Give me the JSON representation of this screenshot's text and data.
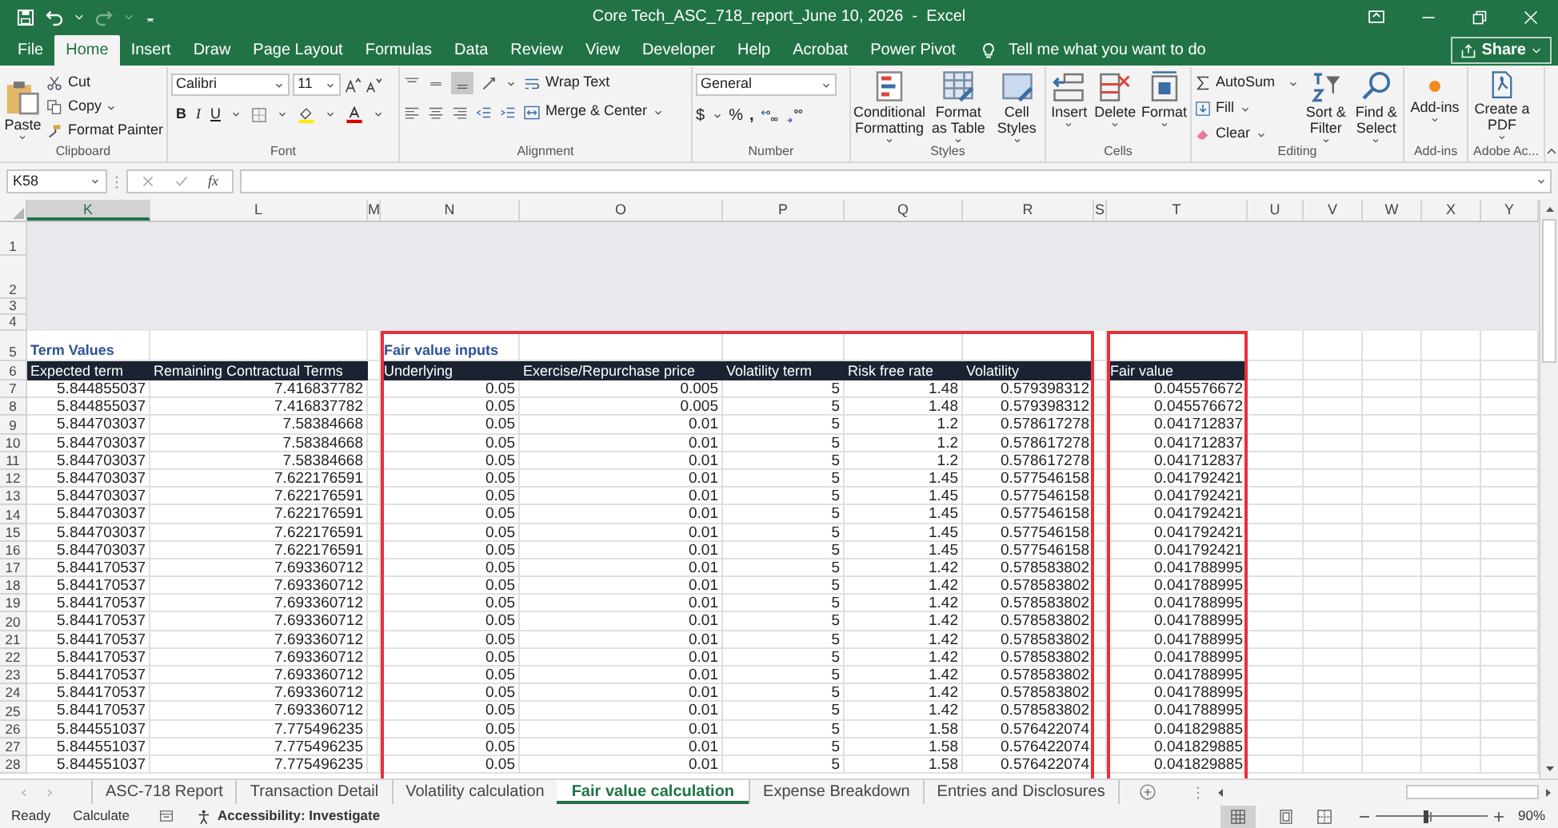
{
  "title_bar": {
    "title": "Core Tech_ASC_718_report_June 10, 2026  -  Excel"
  },
  "menu_tabs": [
    {
      "label": "File",
      "selected": false
    },
    {
      "label": "Home",
      "selected": true
    },
    {
      "label": "Insert",
      "selected": false
    },
    {
      "label": "Draw",
      "selected": false
    },
    {
      "label": "Page Layout",
      "selected": false
    },
    {
      "label": "Formulas",
      "selected": false
    },
    {
      "label": "Data",
      "selected": false
    },
    {
      "label": "Review",
      "selected": false
    },
    {
      "label": "View",
      "selected": false
    },
    {
      "label": "Developer",
      "selected": false
    },
    {
      "label": "Help",
      "selected": false
    },
    {
      "label": "Acrobat",
      "selected": false
    },
    {
      "label": "Power Pivot",
      "selected": false
    }
  ],
  "tell_me": {
    "placeholder": "Tell me what you want to do"
  },
  "share_button": "Share",
  "ribbon": {
    "clipboard": {
      "label": "Clipboard",
      "paste": "Paste",
      "cut": "Cut",
      "copy": "Copy",
      "format_painter": "Format Painter"
    },
    "font": {
      "label": "Font",
      "font_name": "Calibri",
      "font_size": "11",
      "bold": "B",
      "italic": "I",
      "underline": "U"
    },
    "alignment": {
      "label": "Alignment",
      "wrap_text": "Wrap Text",
      "merge_center": "Merge & Center"
    },
    "number": {
      "label": "Number",
      "format": "General",
      "currency": "$",
      "percent": "%",
      "comma": ","
    },
    "styles": {
      "label": "Styles",
      "conditional_formatting": "Conditional Formatting",
      "format_as_table": "Format as Table",
      "cell_styles": "Cell Styles"
    },
    "cells": {
      "label": "Cells",
      "insert": "Insert",
      "delete": "Delete",
      "format": "Format"
    },
    "editing": {
      "label": "Editing",
      "autosum": "AutoSum",
      "fill": "Fill",
      "clear": "Clear",
      "sort_filter": "Sort & Filter",
      "find_select": "Find & Select"
    },
    "add_ins": {
      "label": "Add-ins",
      "add_ins": "Add-ins"
    },
    "adobe": {
      "label": "Adobe Ac...",
      "create_pdf": "Create a PDF"
    }
  },
  "formula_bar": {
    "name_box": "K58",
    "function_button": "fx"
  },
  "sheet": {
    "columns": [
      {
        "label": "K",
        "selected": true
      },
      {
        "label": "L",
        "selected": false
      },
      {
        "label": "M",
        "selected": false
      },
      {
        "label": "N",
        "selected": false
      },
      {
        "label": "O",
        "selected": false
      },
      {
        "label": "P",
        "selected": false
      },
      {
        "label": "Q",
        "selected": false
      },
      {
        "label": "R",
        "selected": false
      },
      {
        "label": "S",
        "selected": false
      },
      {
        "label": "T",
        "selected": false
      },
      {
        "label": "U",
        "selected": false
      },
      {
        "label": "V",
        "selected": false
      },
      {
        "label": "W",
        "selected": false
      },
      {
        "label": "X",
        "selected": false
      },
      {
        "label": "Y",
        "selected": false
      }
    ],
    "rows": [
      {
        "number": "1",
        "kind": "band"
      },
      {
        "number": "2",
        "kind": "band"
      },
      {
        "number": "3",
        "kind": "band"
      },
      {
        "number": "4",
        "kind": "band"
      },
      {
        "number": "5",
        "kind": "section",
        "cells": [
          "Term Values",
          "Fair value inputs"
        ]
      },
      {
        "number": "6",
        "kind": "header",
        "cells": [
          "Expected term",
          "Remaining Contractual Terms",
          "Underlying",
          "Exercise/Repurchase price",
          "Volatility term",
          "Risk free rate",
          "Volatility",
          "Fair value"
        ]
      },
      {
        "number": "7",
        "kind": "data",
        "cells": [
          "5.844855037",
          "7.416837782",
          "0.05",
          "0.005",
          "5",
          "1.48",
          "0.579398312",
          "0.045576672"
        ]
      },
      {
        "number": "8",
        "kind": "data",
        "cells": [
          "5.844855037",
          "7.416837782",
          "0.05",
          "0.005",
          "5",
          "1.48",
          "0.579398312",
          "0.045576672"
        ]
      },
      {
        "number": "9",
        "kind": "data",
        "cells": [
          "5.844703037",
          "7.58384668",
          "0.05",
          "0.01",
          "5",
          "1.2",
          "0.578617278",
          "0.041712837"
        ]
      },
      {
        "number": "10",
        "kind": "data",
        "cells": [
          "5.844703037",
          "7.58384668",
          "0.05",
          "0.01",
          "5",
          "1.2",
          "0.578617278",
          "0.041712837"
        ]
      },
      {
        "number": "11",
        "kind": "data",
        "cells": [
          "5.844703037",
          "7.58384668",
          "0.05",
          "0.01",
          "5",
          "1.2",
          "0.578617278",
          "0.041712837"
        ]
      },
      {
        "number": "12",
        "kind": "data",
        "cells": [
          "5.844703037",
          "7.622176591",
          "0.05",
          "0.01",
          "5",
          "1.45",
          "0.577546158",
          "0.041792421"
        ]
      },
      {
        "number": "13",
        "kind": "data",
        "cells": [
          "5.844703037",
          "7.622176591",
          "0.05",
          "0.01",
          "5",
          "1.45",
          "0.577546158",
          "0.041792421"
        ]
      },
      {
        "number": "14",
        "kind": "data",
        "cells": [
          "5.844703037",
          "7.622176591",
          "0.05",
          "0.01",
          "5",
          "1.45",
          "0.577546158",
          "0.041792421"
        ]
      },
      {
        "number": "15",
        "kind": "data",
        "cells": [
          "5.844703037",
          "7.622176591",
          "0.05",
          "0.01",
          "5",
          "1.45",
          "0.577546158",
          "0.041792421"
        ]
      },
      {
        "number": "16",
        "kind": "data",
        "cells": [
          "5.844703037",
          "7.622176591",
          "0.05",
          "0.01",
          "5",
          "1.45",
          "0.577546158",
          "0.041792421"
        ]
      },
      {
        "number": "17",
        "kind": "data",
        "cells": [
          "5.844170537",
          "7.693360712",
          "0.05",
          "0.01",
          "5",
          "1.42",
          "0.578583802",
          "0.041788995"
        ]
      },
      {
        "number": "18",
        "kind": "data",
        "cells": [
          "5.844170537",
          "7.693360712",
          "0.05",
          "0.01",
          "5",
          "1.42",
          "0.578583802",
          "0.041788995"
        ]
      },
      {
        "number": "19",
        "kind": "data",
        "cells": [
          "5.844170537",
          "7.693360712",
          "0.05",
          "0.01",
          "5",
          "1.42",
          "0.578583802",
          "0.041788995"
        ]
      },
      {
        "number": "20",
        "kind": "data",
        "cells": [
          "5.844170537",
          "7.693360712",
          "0.05",
          "0.01",
          "5",
          "1.42",
          "0.578583802",
          "0.041788995"
        ]
      },
      {
        "number": "21",
        "kind": "data",
        "cells": [
          "5.844170537",
          "7.693360712",
          "0.05",
          "0.01",
          "5",
          "1.42",
          "0.578583802",
          "0.041788995"
        ]
      },
      {
        "number": "22",
        "kind": "data",
        "cells": [
          "5.844170537",
          "7.693360712",
          "0.05",
          "0.01",
          "5",
          "1.42",
          "0.578583802",
          "0.041788995"
        ]
      },
      {
        "number": "23",
        "kind": "data",
        "cells": [
          "5.844170537",
          "7.693360712",
          "0.05",
          "0.01",
          "5",
          "1.42",
          "0.578583802",
          "0.041788995"
        ]
      },
      {
        "number": "24",
        "kind": "data",
        "cells": [
          "5.844170537",
          "7.693360712",
          "0.05",
          "0.01",
          "5",
          "1.42",
          "0.578583802",
          "0.041788995"
        ]
      },
      {
        "number": "25",
        "kind": "data",
        "cells": [
          "5.844170537",
          "7.693360712",
          "0.05",
          "0.01",
          "5",
          "1.42",
          "0.578583802",
          "0.041788995"
        ]
      },
      {
        "number": "26",
        "kind": "data",
        "cells": [
          "5.844551037",
          "7.775496235",
          "0.05",
          "0.01",
          "5",
          "1.58",
          "0.576422074",
          "0.041829885"
        ]
      },
      {
        "number": "27",
        "kind": "data",
        "cells": [
          "5.844551037",
          "7.775496235",
          "0.05",
          "0.01",
          "5",
          "1.58",
          "0.576422074",
          "0.041829885"
        ]
      },
      {
        "number": "28",
        "kind": "data",
        "cells": [
          "5.844551037",
          "7.775496235",
          "0.05",
          "0.01",
          "5",
          "1.58",
          "0.576422074",
          "0.041829885"
        ]
      }
    ],
    "highlight_boxes": {
      "inputs_outlined": true,
      "result_outlined": true
    }
  },
  "sheet_tabs": [
    {
      "label": "ASC-718 Report",
      "selected": false
    },
    {
      "label": "Transaction Detail",
      "selected": false
    },
    {
      "label": "Volatility calculation",
      "selected": false
    },
    {
      "label": "Fair value calculation",
      "selected": true
    },
    {
      "label": "Expense Breakdown",
      "selected": false
    },
    {
      "label": "Entries and Disclosures",
      "selected": false
    }
  ],
  "status_bar": {
    "ready": "Ready",
    "calculate": "Calculate",
    "accessibility": "Accessibility: Investigate",
    "zoom": "90%",
    "zoom_slider": {
      "level": 0.45
    }
  }
}
